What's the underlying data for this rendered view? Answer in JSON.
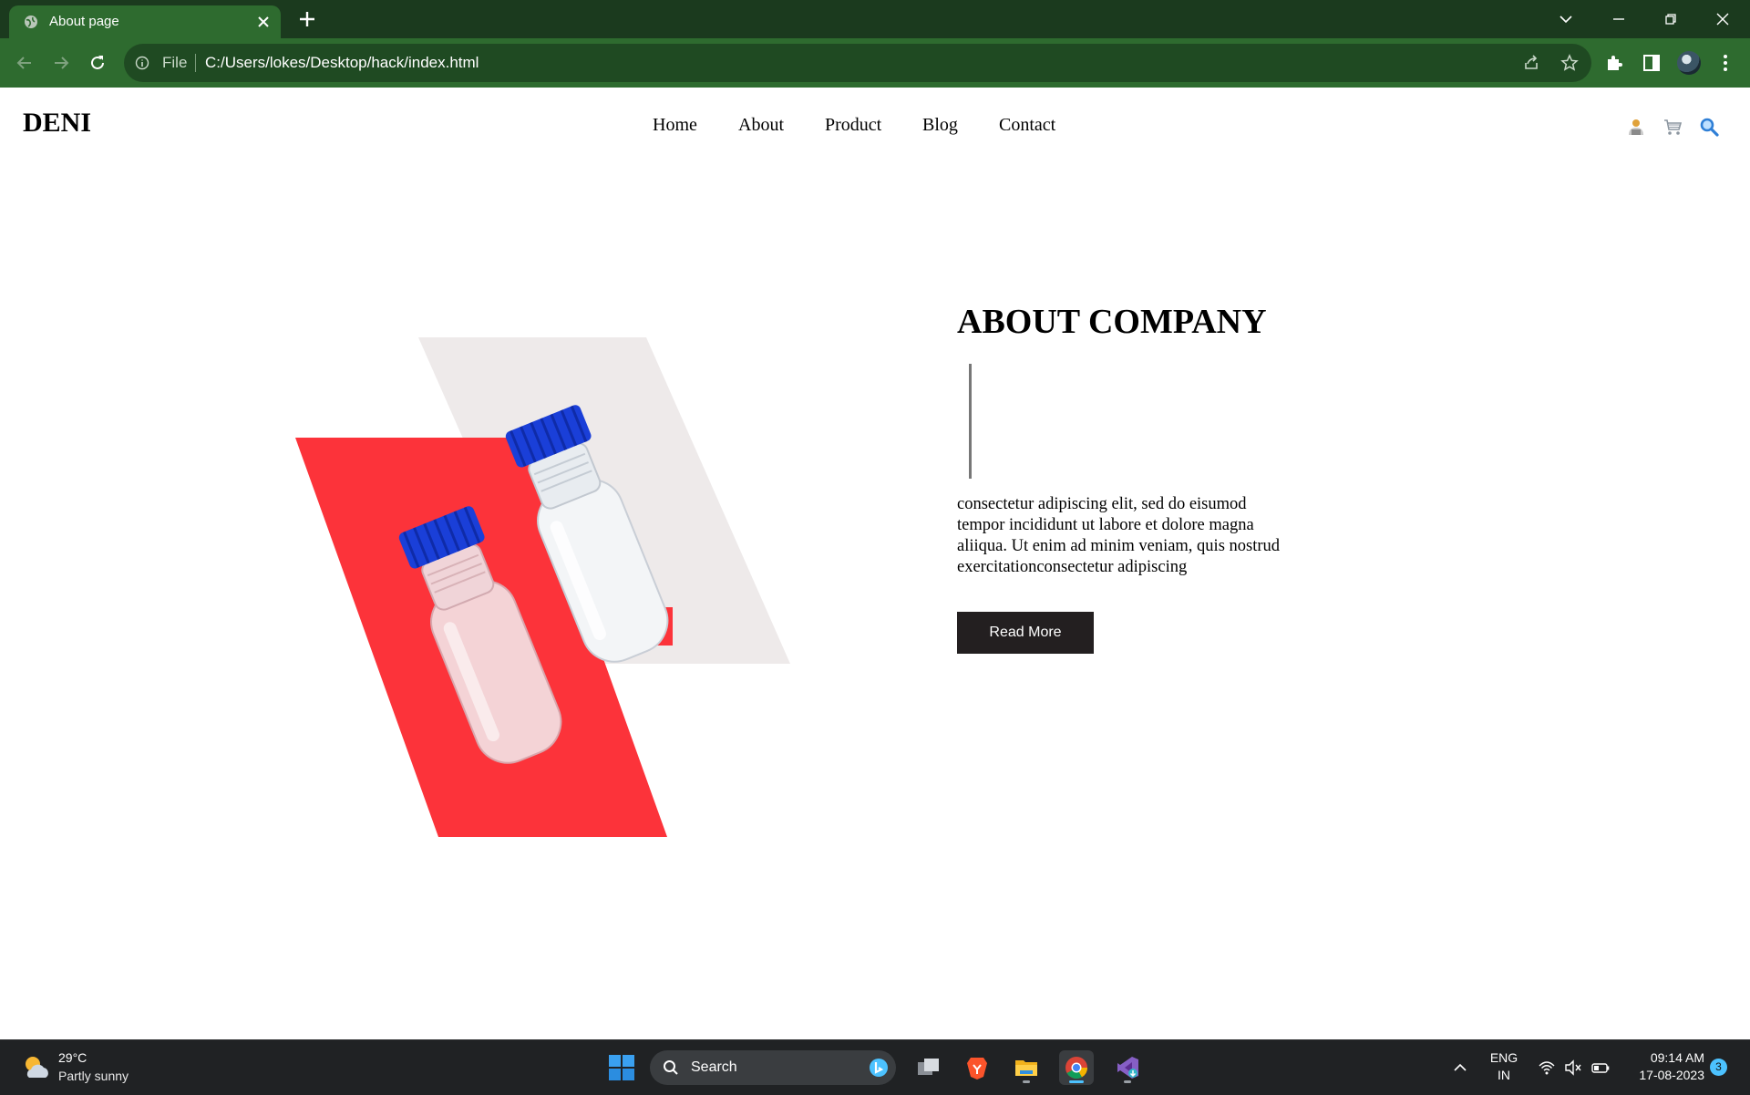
{
  "browser": {
    "tab_title": "About page",
    "address_scheme_label": "File",
    "address_url": "C:/Users/lokes/Desktop/hack/index.html"
  },
  "site": {
    "logo": "DENI",
    "nav": [
      "Home",
      "About",
      "Product",
      "Blog",
      "Contact"
    ],
    "header_icons": [
      "user-icon",
      "cart-icon",
      "search-icon"
    ]
  },
  "about": {
    "title": "ABOUT COMPANY",
    "body": "consectetur adipiscing elit, sed do eisumod tempor incididunt ut labore et dolore magna aliiqua. Ut enim ad minim veniam, quis nostrud exercitationconsectetur adipiscing",
    "button_label": "Read More"
  },
  "colors": {
    "tab_strip": "#1b3a1e",
    "toolbar": "#2e6b2f",
    "accent_red": "#fc333a",
    "shape_gray": "#eeeaea",
    "button_bg": "#231f20",
    "bottle_cap": "#1a3fd8"
  },
  "taskbar": {
    "weather_temp": "29°C",
    "weather_desc": "Partly sunny",
    "search_label": "Search",
    "lang_line1": "ENG",
    "lang_line2": "IN",
    "time": "09:14 AM",
    "date": "17-08-2023",
    "notification_count": "3",
    "apps": [
      "task-view",
      "brave-browser",
      "file-explorer",
      "chrome",
      "visual-studio"
    ]
  }
}
